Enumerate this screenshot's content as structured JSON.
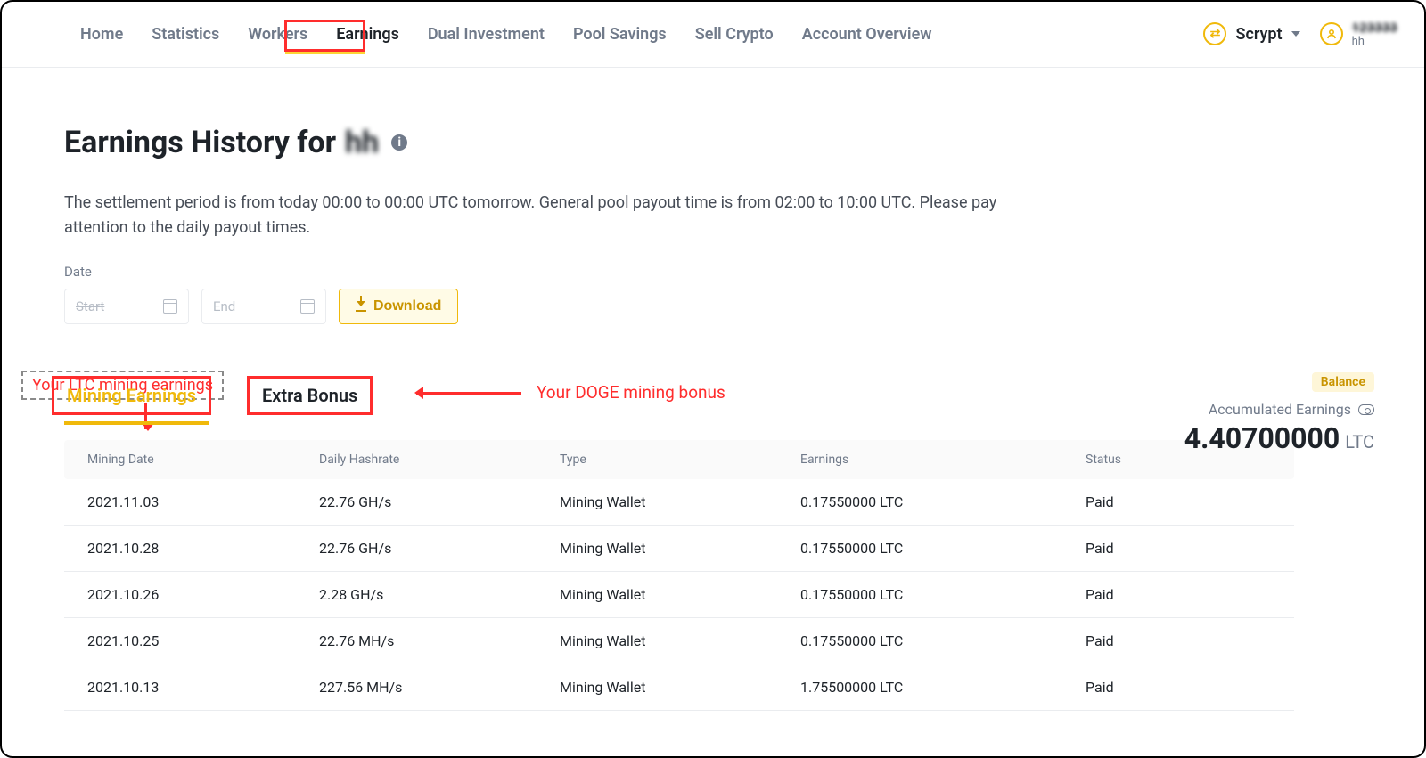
{
  "nav": {
    "items": [
      "Home",
      "Statistics",
      "Workers",
      "Earnings",
      "Dual Investment",
      "Pool Savings",
      "Sell Crypto",
      "Account Overview"
    ],
    "active_index": 3
  },
  "header_right": {
    "algo_label": "Scrypt",
    "user_id_blurred": "123333",
    "user_sub": "hh"
  },
  "page": {
    "title_prefix": "Earnings History for",
    "title_user_blur": "hh",
    "description": "The settlement period is from today 00:00 to 00:00 UTC tomorrow. General pool payout time is from 02:00 to 10:00 UTC. Please pay attention to the daily payout times.",
    "date_label": "Date",
    "start_placeholder": "Start",
    "end_placeholder": "End",
    "download_label": "Download"
  },
  "annotations": {
    "ltc_text": "Your LTC mining earnings",
    "doge_text": "Your DOGE mining bonus"
  },
  "tabs": {
    "mining_earnings": "Mining Earnings",
    "extra_bonus": "Extra Bonus"
  },
  "summary": {
    "balance_pill": "Balance",
    "acc_label": "Accumulated Earnings",
    "acc_value": "4.40700000",
    "acc_unit": "LTC"
  },
  "table": {
    "columns": [
      "Mining Date",
      "Daily Hashrate",
      "Type",
      "Earnings",
      "Status"
    ],
    "rows": [
      {
        "date": "2021.11.03",
        "hashrate": "22.76 GH/s",
        "type": "Mining Wallet",
        "earnings": "0.17550000 LTC",
        "status": "Paid"
      },
      {
        "date": "2021.10.28",
        "hashrate": "22.76 GH/s",
        "type": "Mining Wallet",
        "earnings": "0.17550000 LTC",
        "status": "Paid"
      },
      {
        "date": "2021.10.26",
        "hashrate": "2.28 GH/s",
        "type": "Mining Wallet",
        "earnings": "0.17550000 LTC",
        "status": "Paid"
      },
      {
        "date": "2021.10.25",
        "hashrate": "22.76 MH/s",
        "type": "Mining Wallet",
        "earnings": "0.17550000 LTC",
        "status": "Paid"
      },
      {
        "date": "2021.10.13",
        "hashrate": "227.56 MH/s",
        "type": "Mining Wallet",
        "earnings": "1.75500000 LTC",
        "status": "Paid"
      }
    ]
  }
}
